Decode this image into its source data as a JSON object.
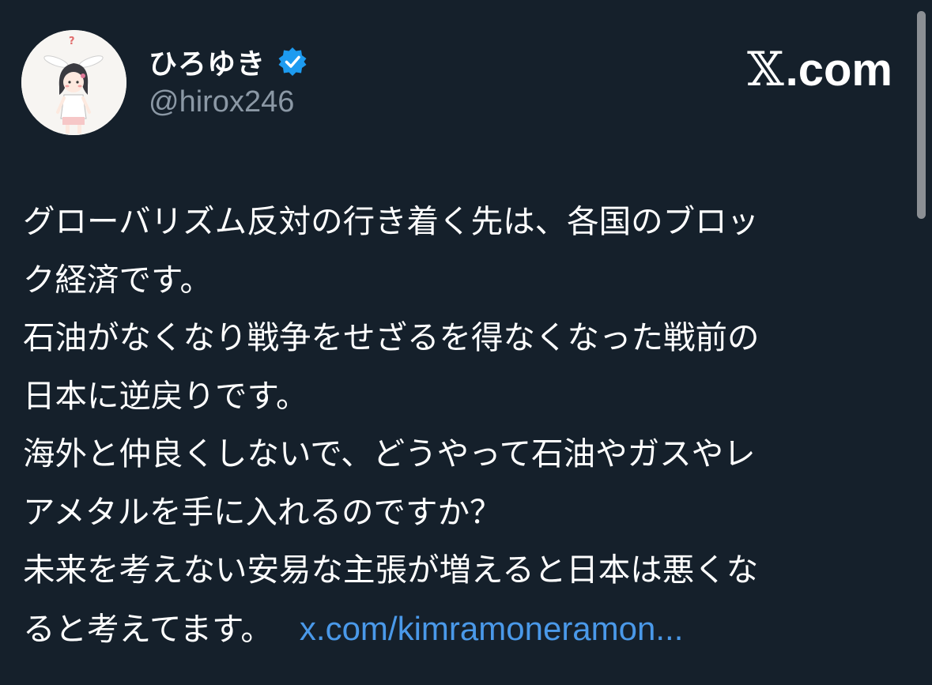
{
  "user": {
    "display_name": "ひろゆき",
    "handle": "@hirox246",
    "verified": true
  },
  "source": {
    "x_glyph": "𝕏",
    "domain_suffix": ".com"
  },
  "tweet": {
    "lines": [
      "グローバリズム反対の行き着く先は、各国のブロッ",
      "ク経済です。",
      "石油がなくなり戦争をせざるを得なくなった戦前の",
      "日本に逆戻りです。",
      "海外と仲良くしないで、どうやって石油やガスやレ",
      "アメタルを手に入れるのですか？",
      "未来を考えない安易な主張が増えると日本は悪くな",
      "ると考えてます。"
    ],
    "link_text": "x.com/kimramoneramon..."
  },
  "colors": {
    "background": "#15202b",
    "text": "#ffffff",
    "muted": "#8b98a5",
    "link": "#4a99e9",
    "verified_badge": "#1d9bf0"
  },
  "icons": {
    "avatar": "cartoon-bunny-ear-character-avatar",
    "verified": "verified-badge-icon"
  }
}
